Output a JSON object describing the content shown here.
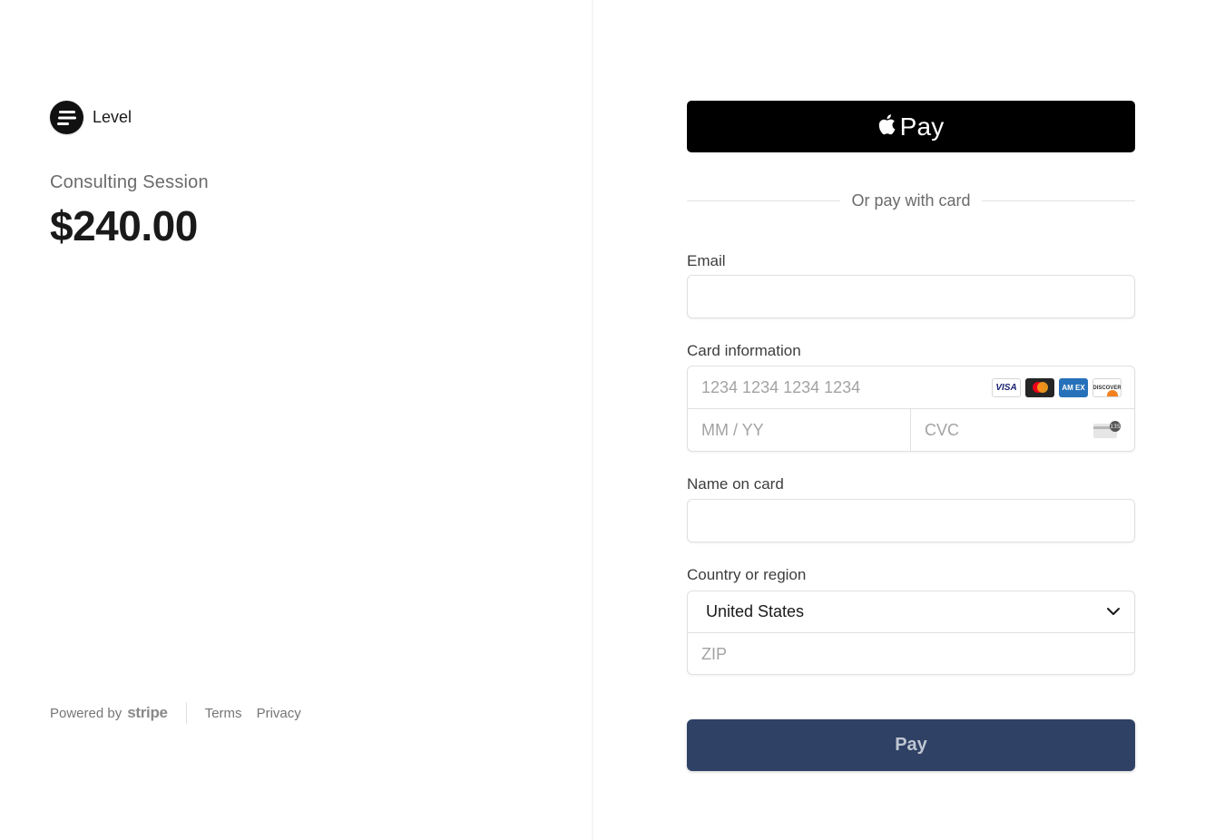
{
  "merchant": {
    "name": "Level",
    "logo_icon": "level-logo-icon"
  },
  "product": {
    "name": "Consulting Session",
    "price": "$240.00"
  },
  "footer": {
    "powered_by": "Powered by",
    "stripe": "stripe",
    "terms": "Terms",
    "privacy": "Privacy"
  },
  "payment": {
    "apple_pay_label": "Pay",
    "apple_icon": "apple-icon",
    "divider_text": "Or pay with card",
    "email": {
      "label": "Email",
      "value": "",
      "placeholder": ""
    },
    "card": {
      "label": "Card information",
      "number_placeholder": "1234 1234 1234 1234",
      "expiry_placeholder": "MM / YY",
      "cvc_placeholder": "CVC",
      "brands": [
        "VISA",
        "Mastercard",
        "AMEX",
        "DISCOVER"
      ],
      "brand_texts": {
        "visa": "VISA",
        "amex": "AM EX",
        "discover": "DISCOVER"
      },
      "cvc_hint": "135"
    },
    "name_on_card": {
      "label": "Name on card",
      "value": ""
    },
    "country": {
      "label": "Country or region",
      "selected": "United States",
      "zip_placeholder": "ZIP"
    },
    "pay_button": "Pay"
  },
  "colors": {
    "pay_button": "#2f4164",
    "apple_pay_button": "#000000",
    "accent_text": "#1a1a1a"
  }
}
